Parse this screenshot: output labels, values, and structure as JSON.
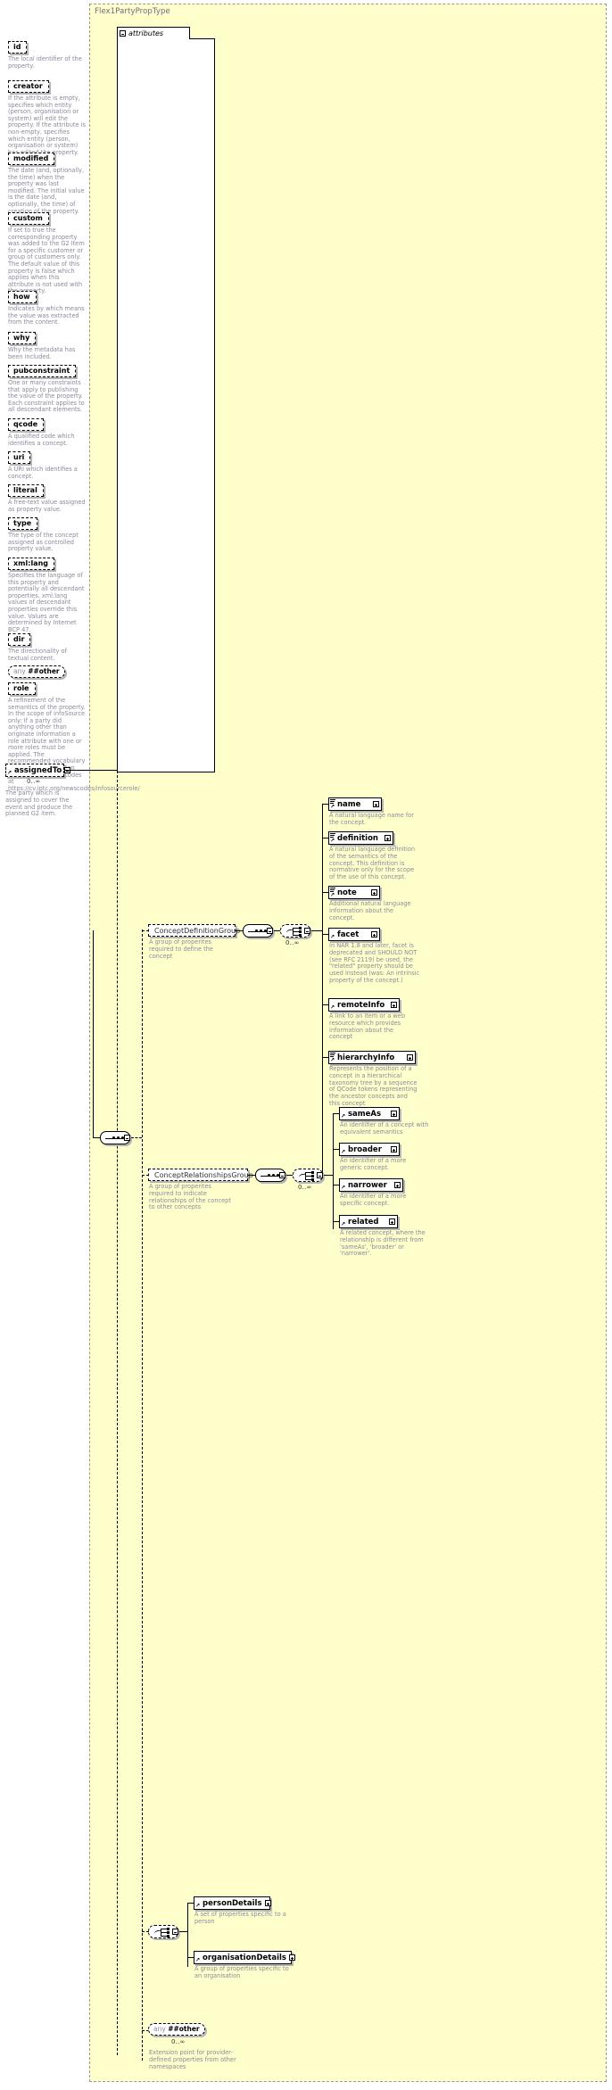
{
  "type": {
    "title": "Flex1PartyPropType",
    "attributes_label": "attributes"
  },
  "attributes": [
    {
      "name": "id",
      "doc": "The local identifier of the property."
    },
    {
      "name": "creator",
      "doc": "If the attribute is empty, specifies which entity (person, organisation or system) will edit the property. If the attribute is non-empty, specifies which entity (person, organisation or system) has edited the property."
    },
    {
      "name": "modified",
      "doc": "The date (and, optionally, the time) when the property was last modified. The initial value is the date (and, optionally, the time) of creation of the property."
    },
    {
      "name": "custom",
      "doc": "If set to true the corresponding property was added to the G2 Item for a specific customer or group of customers only. The default value of this property is false which applies when this attribute is not used with the property."
    },
    {
      "name": "how",
      "doc": "Indicates by which means the value was extracted from the content."
    },
    {
      "name": "why",
      "doc": "Why the metadata has been included."
    },
    {
      "name": "pubconstraint",
      "doc": "One or many constraints that apply to publishing the value of the property. Each constraint applies to all descendant elements."
    },
    {
      "name": "qcode",
      "doc": "A qualified code which identifies a concept."
    },
    {
      "name": "uri",
      "doc": "A URI which identifies a concept."
    },
    {
      "name": "literal",
      "doc": "A free-text value assigned as property value."
    },
    {
      "name": "type",
      "doc": "The type of the concept assigned as controlled property value."
    },
    {
      "name": "xml:lang",
      "doc": "Specifies the language of this property and potentially all descendant properties. xml:lang values of descendant properties override this value. Values are determined by Internet BCP 47."
    },
    {
      "name": "dir",
      "doc": "The directionality of textual content."
    },
    {
      "name": "role",
      "doc": "A refinement of the semantics of the property. In the scope of infoSource only: If a party did anything other than originate information a role attribute with one or more roles must be applied. The recommended vocabulary is the IPTC Information Source Roles NewsCodes at https://cv.iptc.org/newscodes/infosourcerole/"
    }
  ],
  "any_attribute": {
    "prefix": "any",
    "namespace": "##other"
  },
  "assignedTo": {
    "label": "assignedTo",
    "cardinality": "0..∞",
    "doc": "The party which is assigned to cover the event and produce the planned G2 item."
  },
  "concept_definition_group": {
    "label": "ConceptDefinitionGroup",
    "doc": "A group of properites required to define the concept",
    "cardinality": "0..∞",
    "elements": [
      {
        "label": "name",
        "doc": "A natural language name for the concept."
      },
      {
        "label": "definition",
        "doc": "A natural language definition of the semantics of the concept. This definition is normative only for the scope of the use of this concept."
      },
      {
        "label": "note",
        "doc": "Additional natural language information about the concept."
      },
      {
        "label": "facet",
        "doc": "In NAR 1.8 and later, facet is deprecated and SHOULD NOT (see RFC 2119) be used, the \"related\" property should be used instead (was: An intrinsic property of the concept.)"
      },
      {
        "label": "remoteInfo",
        "doc": "A link to an item or a web resource which provides information about the concept"
      },
      {
        "label": "hierarchyInfo",
        "doc": "Represents the position of a concept in a hierarchical taxonomy tree by a sequence of QCode tokens representing the ancestor concepts and this concept"
      }
    ]
  },
  "concept_relationships_group": {
    "label": "ConceptRelationshipsGroup",
    "doc": "A group of properites required to indicate relationships of the concept to other concepts",
    "cardinality": "0..∞",
    "elements": [
      {
        "label": "sameAs",
        "doc": "An identifier of a concept with equivalent semantics"
      },
      {
        "label": "broader",
        "doc": "An identifier of a more generic concept."
      },
      {
        "label": "narrower",
        "doc": "An identifier of a more specific concept."
      },
      {
        "label": "related",
        "doc": "A related concept, where the relationship is different from 'sameAs', 'broader' or 'narrower'."
      }
    ]
  },
  "details_choice": {
    "elements": [
      {
        "label": "personDetails",
        "doc": "A set of properties specific to a person"
      },
      {
        "label": "organisationDetails",
        "doc": "A group of properties specific to an organisation"
      }
    ]
  },
  "any_element": {
    "prefix": "any",
    "namespace": "##other",
    "cardinality": "0..∞",
    "doc": "Extension point for provider-defined properties from other namespaces"
  },
  "colors": {
    "type_background": "#ffffcc",
    "node_background": "#ffffff",
    "doc_text": "#8a8a9e",
    "title_text": "#6b6b8a",
    "shadow": "#b5b5b5"
  }
}
